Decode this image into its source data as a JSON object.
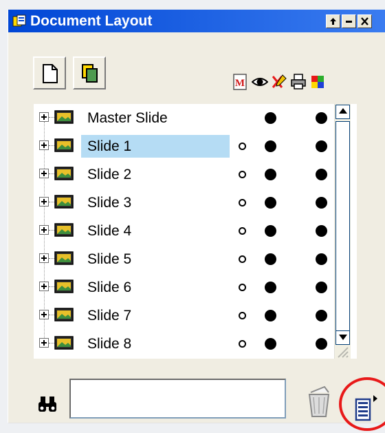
{
  "window": {
    "title": "Document Layout",
    "title_icon": "document-layout-icon",
    "buttons": [
      {
        "name": "pin-button",
        "icon": "pin-icon"
      },
      {
        "name": "minimize-button",
        "icon": "minimize-icon"
      },
      {
        "name": "close-button",
        "icon": "close-icon"
      }
    ]
  },
  "toolbar": {
    "buttons": [
      {
        "name": "new-slide-button",
        "icon": "blank-page-icon"
      },
      {
        "name": "duplicate-slide-button",
        "icon": "duplicate-pages-icon"
      }
    ],
    "column_icons": [
      "pdf-icon",
      "eye-icon",
      "pen-cross-icon",
      "printer-icon",
      "color-palette-icon"
    ]
  },
  "tree": {
    "rows": [
      {
        "label": "Master Slide",
        "selected": false,
        "has_open_circle": false
      },
      {
        "label": "Slide 1",
        "selected": true,
        "has_open_circle": true
      },
      {
        "label": "Slide 2",
        "selected": false,
        "has_open_circle": true
      },
      {
        "label": "Slide 3",
        "selected": false,
        "has_open_circle": true
      },
      {
        "label": "Slide 4",
        "selected": false,
        "has_open_circle": true
      },
      {
        "label": "Slide 5",
        "selected": false,
        "has_open_circle": true
      },
      {
        "label": "Slide 6",
        "selected": false,
        "has_open_circle": true
      },
      {
        "label": "Slide 7",
        "selected": false,
        "has_open_circle": true
      },
      {
        "label": "Slide 8",
        "selected": false,
        "has_open_circle": true
      }
    ]
  },
  "search": {
    "value": "",
    "placeholder": ""
  },
  "colors": {
    "title_bar": "#0046d5",
    "selection": "#b5dcf4",
    "highlight_circle": "#e81919",
    "panel_bg": "#f0ede2"
  }
}
